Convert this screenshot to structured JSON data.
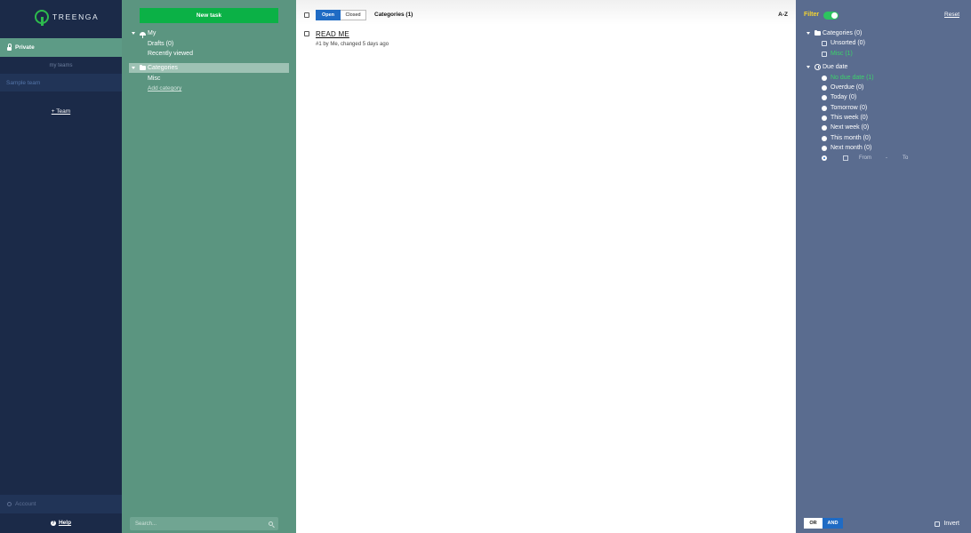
{
  "sidebar": {
    "logo_text": "TREENGA",
    "private_label": "Private",
    "my_teams_label": "my teams",
    "sample_team_label": "Sample team",
    "add_team_label": "+ Team",
    "account_label": "Account",
    "help_label": "Help"
  },
  "tree": {
    "new_task_label": "New task",
    "my_label": "My",
    "drafts_label": "Drafts (0)",
    "recently_viewed_label": "Recently viewed",
    "categories_label": "Categories",
    "misc_label": "Misc",
    "add_category_label": "Add category",
    "search_placeholder": "Search..."
  },
  "main": {
    "open_label": "Open",
    "closed_label": "Closed",
    "categories_count_label": "Categories (1)",
    "sort_label": "A-Z",
    "tasks": [
      {
        "title": "READ ME",
        "meta": "#1 by Me, changed 5 days ago"
      }
    ]
  },
  "filter": {
    "title": "Filter",
    "reset_label": "Reset",
    "categories_label": "Categories (0)",
    "unsorted_label": "Unsorted (0)",
    "misc_label": "Misc (1)",
    "due_date_label": "Due date",
    "due_options": [
      "No due date (1)",
      "Overdue (0)",
      "Today (0)",
      "Tomorrow (0)",
      "This week (0)",
      "Next week (0)",
      "This month (0)",
      "Next month (0)"
    ],
    "range_from_label": "From",
    "range_dash": "-",
    "range_to_label": "To",
    "or_label": "OR",
    "and_label": "AND",
    "invert_label": "Invert"
  },
  "colors": {
    "sidebar_bg": "#1b2a48",
    "tree_bg": "#5b9580",
    "filter_bg": "#5a6c8f",
    "accent_green": "#0bb146",
    "accent_blue": "#1f6bc4",
    "filter_yellow": "#f5d431"
  }
}
